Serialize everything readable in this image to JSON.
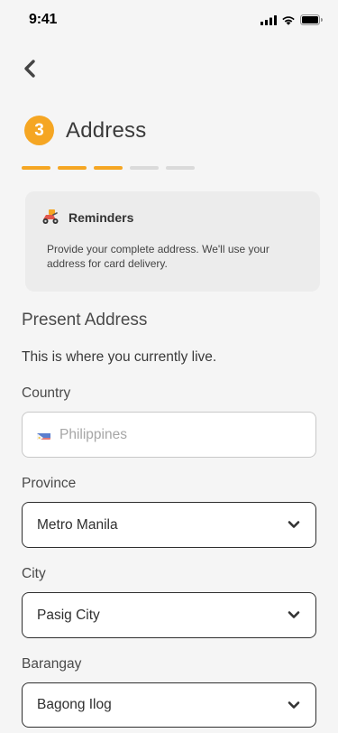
{
  "status_bar": {
    "time": "9:41",
    "icons": [
      "cellular-signal-icon",
      "wifi-icon",
      "battery-icon"
    ]
  },
  "header": {
    "back_icon": "chevron-left-icon"
  },
  "step": {
    "number": "3",
    "title": "Address",
    "progress": {
      "completed": 3,
      "total": 5
    }
  },
  "reminder": {
    "icon": "delivery-scooter-icon",
    "title": "Reminders",
    "body": "Provide your complete address. We'll use your address for card delivery."
  },
  "section": {
    "title": "Present Address",
    "description": "This is where you currently live."
  },
  "fields": {
    "country": {
      "label": "Country",
      "value": "Philippines",
      "flag_icon": "philippines-flag-icon"
    },
    "province": {
      "label": "Province",
      "value": "Metro Manila"
    },
    "city": {
      "label": "City",
      "value": "Pasig City"
    },
    "barangay": {
      "label": "Barangay",
      "value": "Bagong Ilog"
    }
  },
  "colors": {
    "accent": "#f5a623",
    "background": "#f5f5f5",
    "card": "#ececec"
  }
}
